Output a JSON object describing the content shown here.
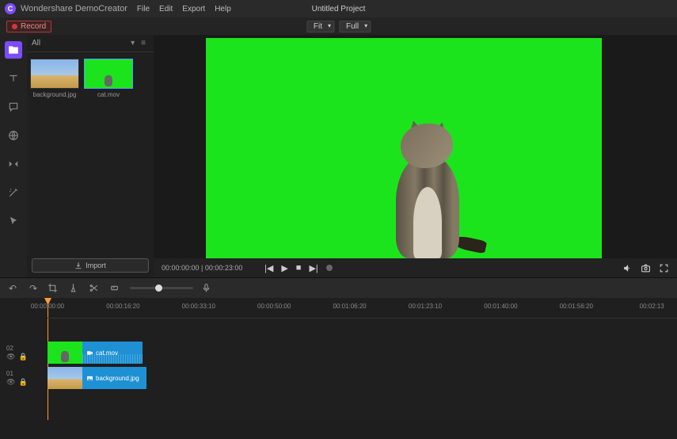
{
  "app": {
    "name": "Wondershare DemoCreator",
    "project_title": "Untitled Project"
  },
  "menu": {
    "file": "File",
    "edit": "Edit",
    "export": "Export",
    "help": "Help"
  },
  "record": {
    "label": "Record"
  },
  "viewport": {
    "fit": "Fit",
    "full": "Full"
  },
  "media": {
    "tab_all": "All",
    "import_label": "Import",
    "items": [
      {
        "label": "background.jpg"
      },
      {
        "label": "cat.mov"
      }
    ]
  },
  "transport": {
    "current": "00:00:00:00",
    "total": "00:00:23:00"
  },
  "ruler": {
    "marks": [
      "00:00:00:00",
      "00:00:16:20",
      "00:00:33:10",
      "00:00:50:00",
      "00:01:06:20",
      "00:01:23:10",
      "00:01:40:00",
      "00:01:56:20",
      "00:02:13"
    ]
  },
  "tracks": {
    "t1": {
      "num": "01"
    },
    "t2": {
      "num": "02"
    },
    "clip_video": "cat.mov",
    "clip_image": "background.jpg"
  }
}
